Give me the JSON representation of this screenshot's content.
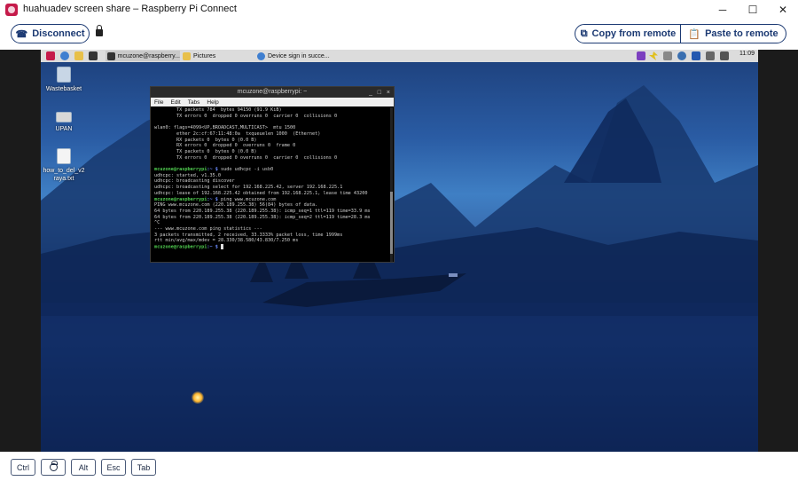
{
  "window": {
    "title": "huahuadev screen share – Raspberry Pi Connect",
    "minimize": "─",
    "maximize": "☐",
    "close": "✕"
  },
  "toolbar": {
    "disconnect_label": "Disconnect",
    "copy_label": "Copy from remote",
    "paste_label": "Paste to remote"
  },
  "remote": {
    "taskbar": {
      "tasks": [
        {
          "label": "mcuzone@raspberry..."
        },
        {
          "label": "Pictures"
        },
        {
          "label": "Device sign in succe..."
        }
      ],
      "clock": "11:09"
    },
    "desktop_icons": [
      {
        "label": "Wastebasket"
      },
      {
        "label": "UPAN"
      },
      {
        "label": "how_to_del_v2 raya.txt"
      }
    ],
    "terminal": {
      "title": "mcuzone@raspberrypi: ~",
      "menu": [
        "File",
        "Edit",
        "Tabs",
        "Help"
      ],
      "lines": [
        {
          "t": "        TX packets 784  bytes 94150 (91.9 KiB)"
        },
        {
          "t": "        TX errors 0  dropped 0 overruns 0  carrier 0  collisions 0"
        },
        {
          "t": ""
        },
        {
          "t": "wlan0: flags=4099<UP,BROADCAST,MULTICAST>  mtu 1500"
        },
        {
          "t": "        ether 2c:cf:67:11:48:0a  txqueuelen 1000  (Ethernet)"
        },
        {
          "t": "        RX packets 0  bytes 0 (0.0 B)"
        },
        {
          "t": "        RX errors 0  dropped 0  overruns 0  frame 0"
        },
        {
          "t": "        TX packets 0  bytes 0 (0.0 B)"
        },
        {
          "t": "        TX errors 0  dropped 0 overruns 0  carrier 0  collisions 0"
        },
        {
          "t": ""
        },
        {
          "p": "mcuzone@raspberrypi",
          "path": ":~ $",
          "t": " sudo udhcpc -i usb0"
        },
        {
          "t": "udhcpc: started, v1.35.0"
        },
        {
          "t": "udhcpc: broadcasting discover"
        },
        {
          "t": "udhcpc: broadcasting select for 192.168.225.42, server 192.168.225.1"
        },
        {
          "t": "udhcpc: lease of 192.168.225.42 obtained from 192.168.225.1, lease time 43200"
        },
        {
          "p": "mcuzone@raspberrypi",
          "path": ":~ $",
          "t": " ping www.mcuzone.com"
        },
        {
          "t": "PING www.mcuzone.com (220.189.255.38) 56(84) bytes of data."
        },
        {
          "t": "64 bytes from 220.189.255.38 (220.189.255.38): icmp_seq=1 ttl=119 time=33.9 ms"
        },
        {
          "t": "64 bytes from 220.189.255.38 (220.189.255.38): icmp_seq=2 ttl=119 time=28.3 ms"
        },
        {
          "t": "^C"
        },
        {
          "t": "--- www.mcuzone.com ping statistics ---"
        },
        {
          "t": "3 packets transmitted, 2 received, 33.3333% packet loss, time 1999ms"
        },
        {
          "t": "rtt min/avg/max/mdev = 28.330/38.580/43.830/7.250 ms"
        },
        {
          "p": "mcuzone@raspberrypi",
          "path": ":~ $",
          "t": " ",
          "cursor": true
        }
      ]
    }
  },
  "bottom": {
    "keys": [
      "Ctrl",
      "Alt",
      "Esc",
      "Tab"
    ]
  },
  "colors": {
    "accent": "#1c3a73",
    "raspberry": "#c51a4a",
    "terminal_bg": "#000000",
    "prompt_green": "#4fcc4f",
    "prompt_blue": "#6c8cff"
  }
}
